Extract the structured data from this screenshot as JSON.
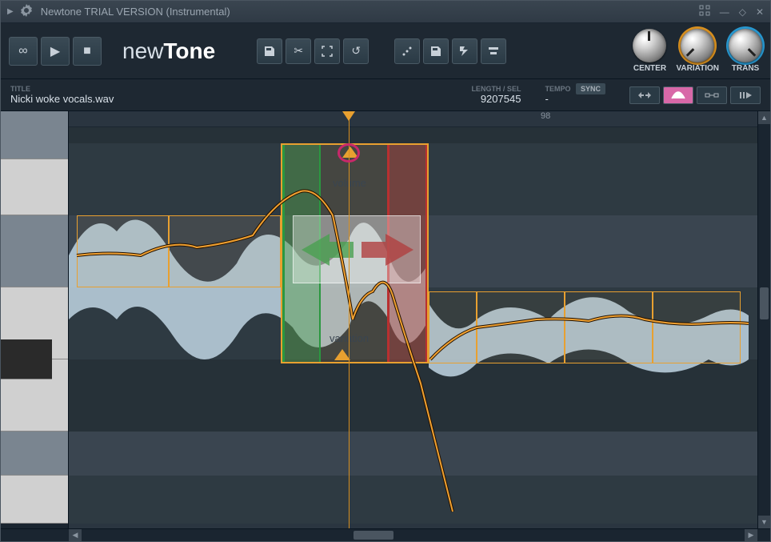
{
  "titlebar": {
    "title": "Newtone TRIAL VERSION (Instrumental)"
  },
  "toolbar": {
    "loop": "∞",
    "play": "▶",
    "stop": "■",
    "logo_a": "new",
    "logo_b": "Tone",
    "save": "💾",
    "cut": "✂",
    "select": "⛶",
    "undo": "↺",
    "snap": "⋰",
    "save2": "💾",
    "send": "▸",
    "option": "⊟"
  },
  "knobs": {
    "center": "CENTER",
    "variation": "VARIATION",
    "trans": "TRANS"
  },
  "info": {
    "title_label": "TITLE",
    "title_value": "Nicki woke vocals.wav",
    "length_label": "LENGTH / SEL",
    "length_value": "9207545",
    "tempo_label": "TEMPO",
    "tempo_value": "-",
    "sync": "SYNC"
  },
  "ruler": {
    "marker": "98"
  },
  "annotations": {
    "volume": "volume",
    "variation": "variation"
  },
  "modes": {
    "m1": "⇄",
    "m2": "⌒",
    "m3": "⊡",
    "m4": "‖▸"
  }
}
